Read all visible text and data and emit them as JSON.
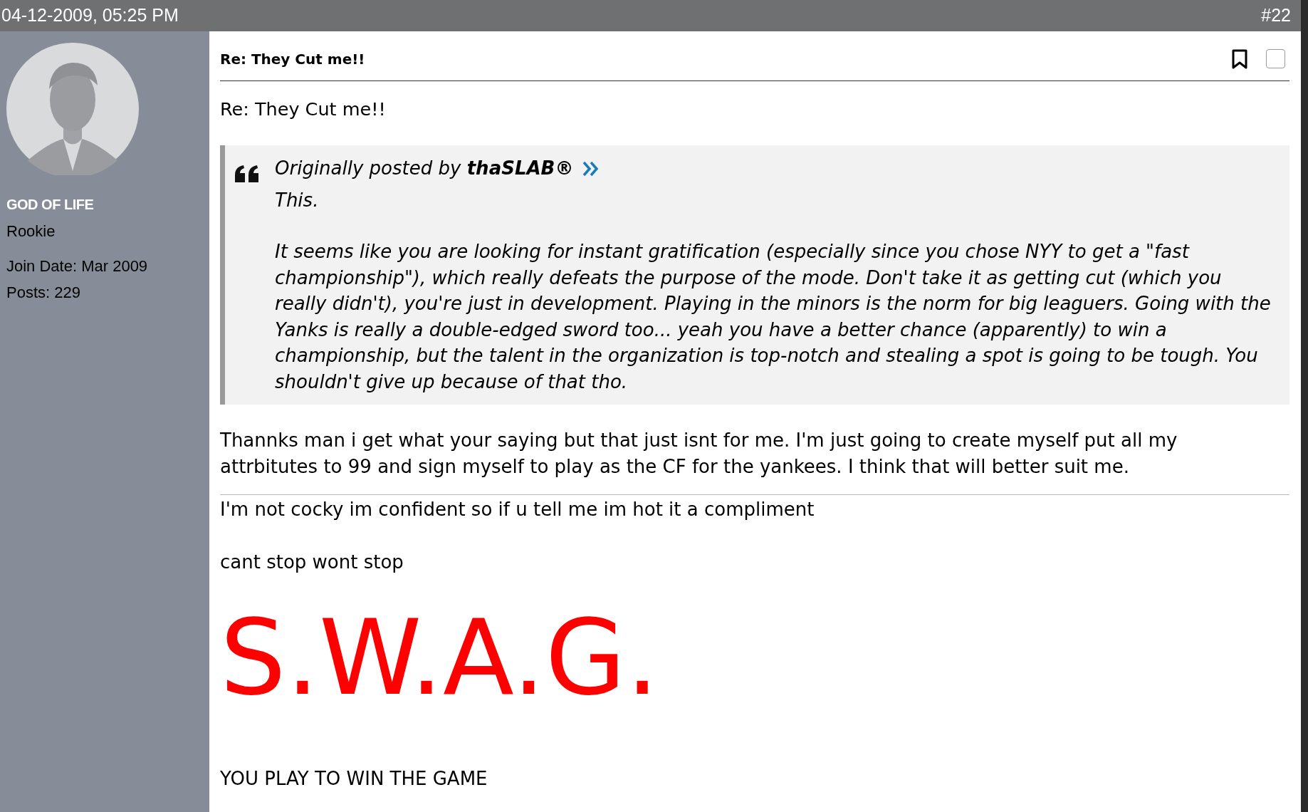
{
  "post_header": {
    "date": "04-12-2009, 05:25 PM",
    "number": "#22"
  },
  "author": {
    "name": "GOD OF LIFE",
    "rank": "Rookie",
    "join_date": "Join Date: Mar 2009",
    "posts": "Posts: 229"
  },
  "post": {
    "title": "Re: They Cut me!!",
    "select_checkbox": {
      "checked": false
    },
    "subject": "Re: They Cut me!!",
    "quote": {
      "attribution": "Originally posted by **thaSLAB®**",
      "paragraphs": [
        "This.",
        "It seems like you are looking for instant gratification (especially since you chose NYY to get a \"fast championship\"), which really defeats the purpose of the mode. Don't take it as getting cut (which you really didn't), you're just in development. Playing in the minors is the norm for big leaguers. Going with the Yanks is really a double-edged sword too... yeah you have a better chance (apparently) to win a championship, but the talent in the organization is top-notch and stealing a spot is going to be tough. You shouldn't give up because of that tho."
      ]
    },
    "body": "Thannks man i get what your saying but that just isnt for me. I'm just going to create myself put all my attrbitutes to 99 and sign myself to play as the CF for the yankees. I think that will better suit me.",
    "signature": [
      {
        "kind": "text",
        "text": "I'm not cocky im confident so if u tell me im hot it a compliment"
      },
      {
        "kind": "text",
        "text": "cant stop wont stop"
      },
      {
        "kind": "big",
        "text": "S.W.A.G.",
        "color": "#ff0000"
      },
      {
        "kind": "text",
        "text": "YOU PLAY TO WIN THE GAME"
      }
    ]
  }
}
